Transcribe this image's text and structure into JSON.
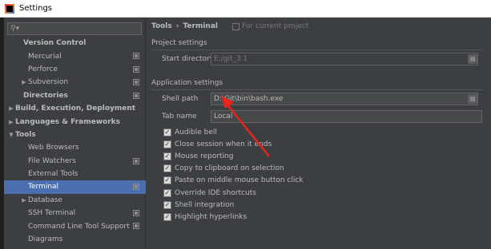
{
  "window": {
    "title": "Settings"
  },
  "search": {
    "placeholder": ""
  },
  "sidebar": {
    "items": [
      {
        "label": "Version Control",
        "level": 1,
        "bold": true,
        "arrow": "",
        "project_icon": false,
        "selected": false
      },
      {
        "label": "Mercurial",
        "level": 2,
        "bold": false,
        "arrow": "",
        "project_icon": true,
        "selected": false
      },
      {
        "label": "Perforce",
        "level": 2,
        "bold": false,
        "arrow": "",
        "project_icon": true,
        "selected": false
      },
      {
        "label": "Subversion",
        "level": 2,
        "bold": false,
        "arrow": "▶",
        "project_icon": true,
        "selected": false
      },
      {
        "label": "Directories",
        "level": 1,
        "bold": true,
        "arrow": "",
        "project_icon": true,
        "selected": false
      },
      {
        "label": "Build, Execution, Deployment",
        "level": 0,
        "bold": true,
        "arrow": "▶",
        "project_icon": false,
        "selected": false
      },
      {
        "label": "Languages & Frameworks",
        "level": 0,
        "bold": true,
        "arrow": "▶",
        "project_icon": false,
        "selected": false
      },
      {
        "label": "Tools",
        "level": 0,
        "bold": true,
        "arrow": "▼",
        "project_icon": false,
        "selected": false
      },
      {
        "label": "Web Browsers",
        "level": 2,
        "bold": false,
        "arrow": "",
        "project_icon": false,
        "selected": false
      },
      {
        "label": "File Watchers",
        "level": 2,
        "bold": false,
        "arrow": "",
        "project_icon": true,
        "selected": false
      },
      {
        "label": "External Tools",
        "level": 2,
        "bold": false,
        "arrow": "",
        "project_icon": false,
        "selected": false
      },
      {
        "label": "Terminal",
        "level": 2,
        "bold": false,
        "arrow": "",
        "project_icon": true,
        "selected": true
      },
      {
        "label": "Database",
        "level": 2,
        "bold": false,
        "arrow": "▶",
        "project_icon": false,
        "selected": false
      },
      {
        "label": "SSH Terminal",
        "level": 2,
        "bold": false,
        "arrow": "",
        "project_icon": true,
        "selected": false
      },
      {
        "label": "Command Line Tool Support",
        "level": 2,
        "bold": false,
        "arrow": "",
        "project_icon": true,
        "selected": false
      },
      {
        "label": "Diagrams",
        "level": 2,
        "bold": false,
        "arrow": "",
        "project_icon": false,
        "selected": false
      }
    ]
  },
  "breadcrumb": {
    "parent": "Tools",
    "separator": "›",
    "current": "Terminal",
    "project_note": "For current project"
  },
  "project_settings": {
    "title": "Project settings",
    "start_directory_label": "Start directory",
    "start_directory_value": "E:/git_3.1"
  },
  "app_settings": {
    "title": "Application settings",
    "shell_path_label": "Shell path",
    "shell_path_value": "D:\\Git\\bin\\bash.exe",
    "tab_name_label": "Tab name",
    "tab_name_value": "Local",
    "checkboxes": [
      {
        "label": "Audible bell",
        "checked": true
      },
      {
        "label": "Close session when it ends",
        "checked": true
      },
      {
        "label": "Mouse reporting",
        "checked": true
      },
      {
        "label": "Copy to clipboard on selection",
        "checked": true
      },
      {
        "label": "Paste on middle mouse button click",
        "checked": true
      },
      {
        "label": "Override IDE shortcuts",
        "checked": true
      },
      {
        "label": "Shell integration",
        "checked": true
      },
      {
        "label": "Highlight hyperlinks",
        "checked": true
      }
    ]
  },
  "annotation": {
    "arrow_color": "#e8241b"
  }
}
